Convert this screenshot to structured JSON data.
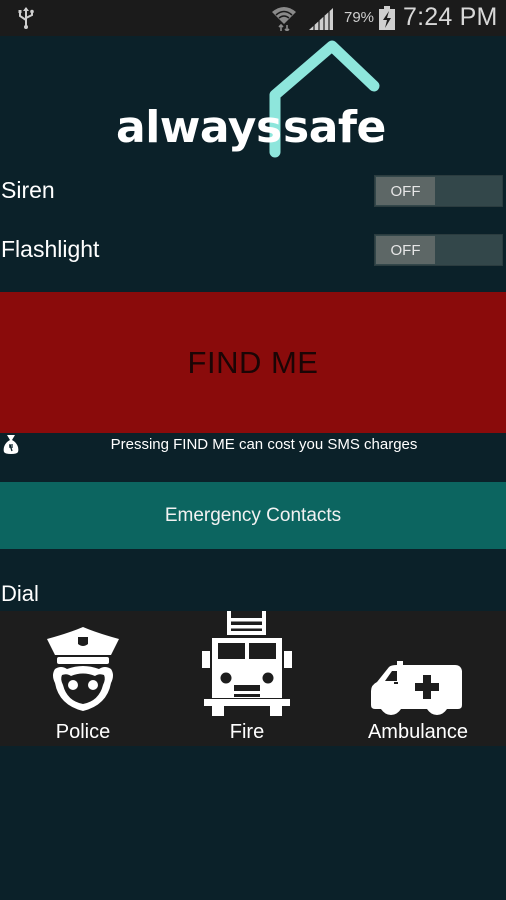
{
  "status_bar": {
    "icons": [
      "usb-icon",
      "wifi-icon",
      "signal-icon",
      "battery-charging-icon"
    ],
    "battery_percent": "79%",
    "time": "7:24 PM"
  },
  "logo": {
    "word_left": "always",
    "word_right": "safe",
    "accent_color": "#8ee6dc"
  },
  "settings": [
    {
      "label": "Siren",
      "state": "OFF",
      "enabled": false
    },
    {
      "label": "Flashlight",
      "state": "OFF",
      "enabled": false
    }
  ],
  "find_me": {
    "label": "FIND ME",
    "color": "#8a0b0b"
  },
  "sms_note": {
    "icon": "money-bag-icon",
    "text": "Pressing FIND ME can cost you SMS charges"
  },
  "emergency_contacts": {
    "label": "Emergency Contacts",
    "color": "#0c6560"
  },
  "dial": {
    "label": "Dial",
    "items": [
      {
        "label": "Police",
        "icon": "police-officer-icon"
      },
      {
        "label": "Fire",
        "icon": "fire-truck-icon"
      },
      {
        "label": "Ambulance",
        "icon": "ambulance-icon"
      }
    ]
  }
}
